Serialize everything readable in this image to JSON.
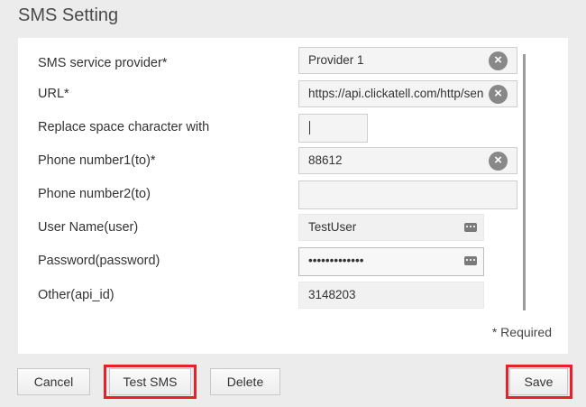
{
  "title": "SMS Setting",
  "fields": [
    {
      "label": "SMS service provider*",
      "value": "Provider 1"
    },
    {
      "label": "URL*",
      "value": "https://api.clickatell.com/http/sendmsg"
    },
    {
      "label": "Replace space character with",
      "value": ""
    },
    {
      "label": "Phone number1(to)*",
      "value": "88612"
    },
    {
      "label": "Phone number2(to)",
      "value": ""
    },
    {
      "label": "User Name(user)",
      "value": "TestUser"
    },
    {
      "label": "Password(password)",
      "value": "•••••••••••••"
    },
    {
      "label": "Other(api_id)",
      "value": "3148203"
    }
  ],
  "required_note": "* Required",
  "buttons": {
    "cancel": "Cancel",
    "test_sms": "Test SMS",
    "delete": "Delete",
    "save": "Save"
  },
  "icons": {
    "clear": "clear-icon",
    "keyboard": "keyboard-icon"
  },
  "colors": {
    "highlight": "#e8202a",
    "background": "#ececec",
    "panel": "#ffffff"
  }
}
